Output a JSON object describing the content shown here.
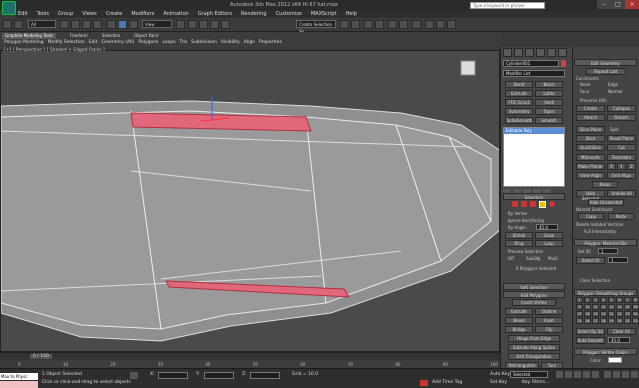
{
  "title": {
    "window": "Autodesk 3ds Max 2012 x64    Hi 67 hat.max",
    "search_placeholder": "Type a keyword or phrase"
  },
  "menu": [
    "Edit",
    "Tools",
    "Group",
    "Views",
    "Create",
    "Modifiers",
    "Animation",
    "Graph Editors",
    "Rendering",
    "Customize",
    "MAXScript",
    "Help"
  ],
  "toolbar": {
    "filter": "All",
    "view": "View",
    "selset": "Create Selection Se"
  },
  "ribbon": {
    "tabs": [
      "Graphite Modeling Tools",
      "Freeform",
      "Selection",
      "Object Paint"
    ],
    "row": [
      "Polygon Modeling",
      "Modify Selection",
      "Edit",
      "Geometry (All)",
      "Polygons",
      "Loops",
      "Tris",
      "Subdivision",
      "Visibility",
      "Align",
      "Properties"
    ]
  },
  "viewport": {
    "label": "[+] [ Perspective ] [ Shaded + Edged Faces ]"
  },
  "cmd": {
    "object_name": "Cylinder001",
    "modifier_list": "Modifier List",
    "buttons": [
      "Bend",
      "Noise",
      "Extrude",
      "Lathe",
      "FFD 3x3x3",
      "Shell",
      "Symmetry",
      "Taper",
      "TurboSmooth",
      "Smooth"
    ],
    "stack_item": "Editable Poly",
    "selection_header": "Selection",
    "by_vertex": "By Vertex",
    "ignore_backfacing": "Ignore Backfacing",
    "by_angle": "By Angle:",
    "by_angle_val": "45.0",
    "shrink": "Shrink",
    "grow": "Grow",
    "ring": "Ring",
    "loop": "Loop",
    "preview_selection": "Preview Selection",
    "off": "Off",
    "subobj": "SubObj",
    "multi": "Multi",
    "poly_selected": "6 Polygons Selected",
    "soft_selection": "Soft Selection",
    "edit_polygons": "Edit Polygons",
    "insert_vertex": "Insert Vertex",
    "extrude": "Extrude",
    "outline": "Outline",
    "bevel": "Bevel",
    "inset": "Inset",
    "bridge": "Bridge",
    "flip": "Flip",
    "hinge": "Hinge From Edge",
    "extrude_spline": "Extrude Along Spline",
    "edit_triangulation": "Edit Triangulation",
    "retriangulate": "Retriangulate",
    "turn": "Turn"
  },
  "edit_geometry": {
    "header": "Edit Geometry",
    "repeat_last": "Repeat Last",
    "constraints": "Constraints",
    "none": "None",
    "edge": "Edge",
    "face": "Face",
    "normal": "Normal",
    "preserve_uvs": "Preserve UVs",
    "create": "Create",
    "collapse": "Collapse",
    "attach": "Attach",
    "detach": "Detach",
    "slice_plane": "Slice Plane",
    "split": "Split",
    "slice": "Slice",
    "reset_plane": "Reset Plane",
    "quickslice": "QuickSlice",
    "cut": "Cut",
    "msmooth": "MSmooth",
    "tessellate": "Tessellate",
    "make_planar": "Make Planar",
    "x": "X",
    "y": "Y",
    "z": "Z",
    "view_align": "View Align",
    "grid_align": "Grid Align",
    "relax": "Relax",
    "hide_selected": "Hide Selected",
    "unhide_all": "Unhide All",
    "hide_unselected": "Hide Unselected",
    "named_selections": "Named Selections:",
    "copy": "Copy",
    "paste": "Paste",
    "delete_isolated": "Delete Isolated Vertices",
    "full_interactivity": "Full Interactivity"
  },
  "material_ids": {
    "header": "Polygon: Material IDs",
    "set_id": "Set ID:",
    "set_id_val": "1",
    "select_id": "Select ID",
    "select_id_val": "1",
    "clear_selection": "Clear Selection"
  },
  "smoothing": {
    "header": "Polygon: Smoothing Groups",
    "groups": [
      "1",
      "2",
      "3",
      "4",
      "5",
      "6",
      "7",
      "8",
      "9",
      "10",
      "11",
      "12",
      "13",
      "14",
      "15",
      "16",
      "17",
      "18",
      "19",
      "20",
      "21",
      "22",
      "23",
      "24",
      "25",
      "26",
      "27",
      "28",
      "29",
      "30",
      "31",
      "32"
    ],
    "select_by_sg": "Select By SG",
    "clear_all": "Clear All",
    "auto_smooth": "Auto Smooth",
    "auto_smooth_val": "45.0"
  },
  "vertex_colors": {
    "header": "Polygon: Vertex Colors",
    "color": "Color:"
  },
  "timeline": {
    "frame": "0 / 100",
    "ticks": [
      "0",
      "10",
      "20",
      "30",
      "40",
      "50",
      "60",
      "70",
      "80",
      "90",
      "100"
    ]
  },
  "status": {
    "maxscript": "Max to Physc.",
    "selected": "1 Object Selected",
    "prompt": "Click or click-and-drag to select objects",
    "x": "X:",
    "y": "Y:",
    "z": "Z:",
    "grid": "Grid = 10.0",
    "auto_key": "Auto Key",
    "selected_dd": "Selected",
    "set_key": "Set Key",
    "key_filters": "Key Filters...",
    "add_time_tag": "Add Time Tag"
  },
  "colors": {
    "selection_red": "#e0687a",
    "viewport_bg": "#4a4a4a"
  }
}
